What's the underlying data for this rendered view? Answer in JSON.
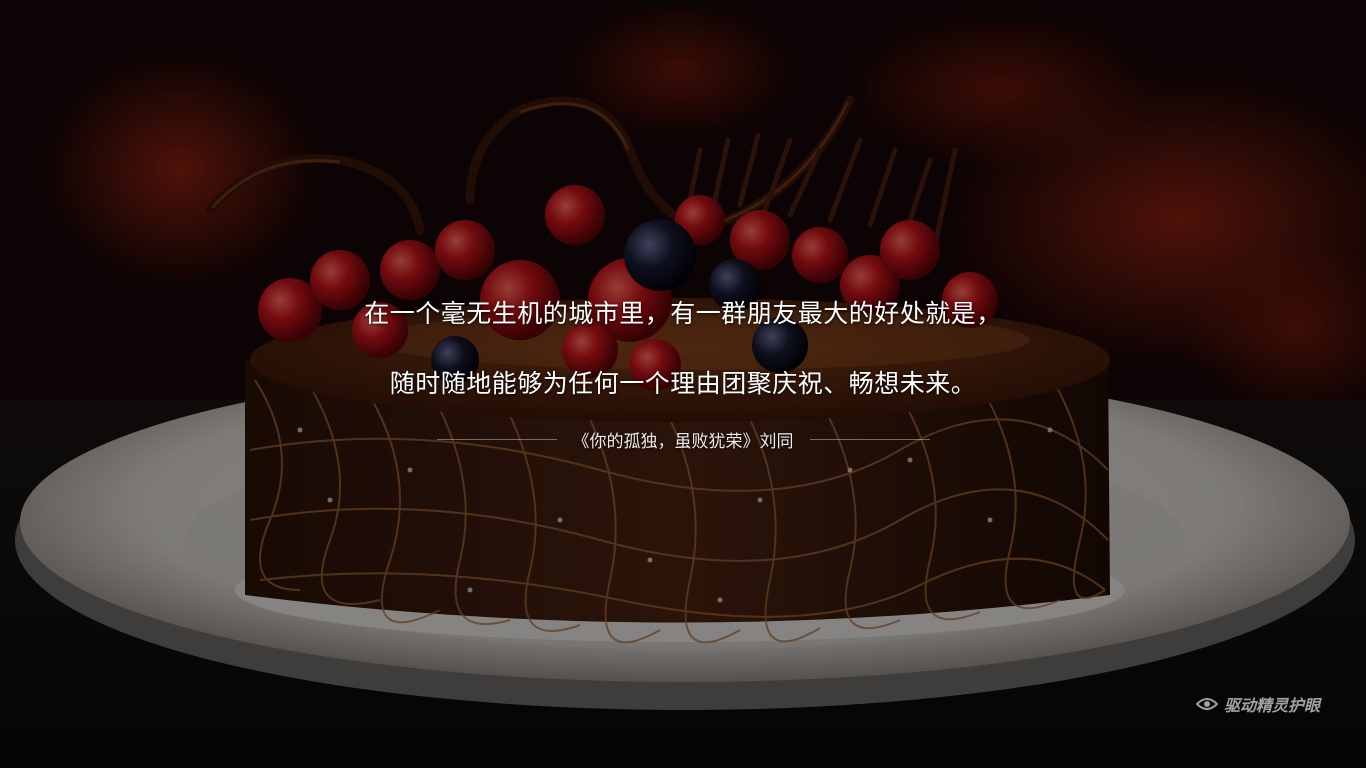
{
  "quote": {
    "line1": "在一个毫无生机的城市里，有一群朋友最大的好处就是，",
    "line2": "随时随地能够为任何一个理由团聚庆祝、畅想未来。",
    "source": "《你的孤独，虽败犹荣》刘同"
  },
  "watermark": {
    "label": "驱动精灵护眼",
    "icon": "eye-icon"
  },
  "colors": {
    "background_dark": "#120606",
    "ember_red": "#8a1a0c",
    "plate": "#d8d3cf",
    "chocolate": "#3a1c0f",
    "berry": "#b0121a",
    "text": "#ffffff"
  }
}
